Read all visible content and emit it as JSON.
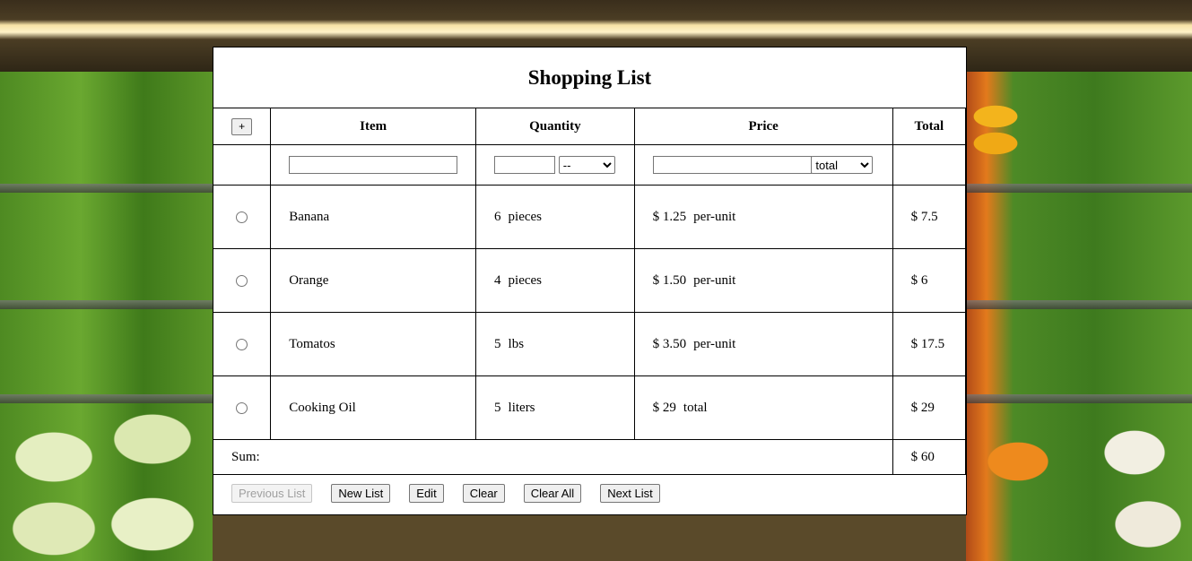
{
  "title": "Shopping List",
  "header": {
    "add_label": "+",
    "item": "Item",
    "quantity": "Quantity",
    "price": "Price",
    "total": "Total"
  },
  "inputs": {
    "item_value": "",
    "quantity_value": "",
    "unit_selected": "--",
    "price_value": "",
    "price_mode_selected": "total"
  },
  "items": [
    {
      "name": "Banana",
      "qty": "6",
      "unit": "pieces",
      "price": "$ 1.25",
      "mode": "per-unit",
      "total": "$ 7.5"
    },
    {
      "name": "Orange",
      "qty": "4",
      "unit": "pieces",
      "price": "$ 1.50",
      "mode": "per-unit",
      "total": "$ 6"
    },
    {
      "name": "Tomatos",
      "qty": "5",
      "unit": "lbs",
      "price": "$ 3.50",
      "mode": "per-unit",
      "total": "$ 17.5"
    },
    {
      "name": "Cooking Oil",
      "qty": "5",
      "unit": "liters",
      "price": "$ 29",
      "mode": "total",
      "total": "$ 29"
    }
  ],
  "sum": {
    "label": "Sum:",
    "value": "$ 60"
  },
  "footer": {
    "previous": "Previous List",
    "new": "New List",
    "edit": "Edit",
    "clear": "Clear",
    "clear_all": "Clear All",
    "next": "Next List"
  }
}
